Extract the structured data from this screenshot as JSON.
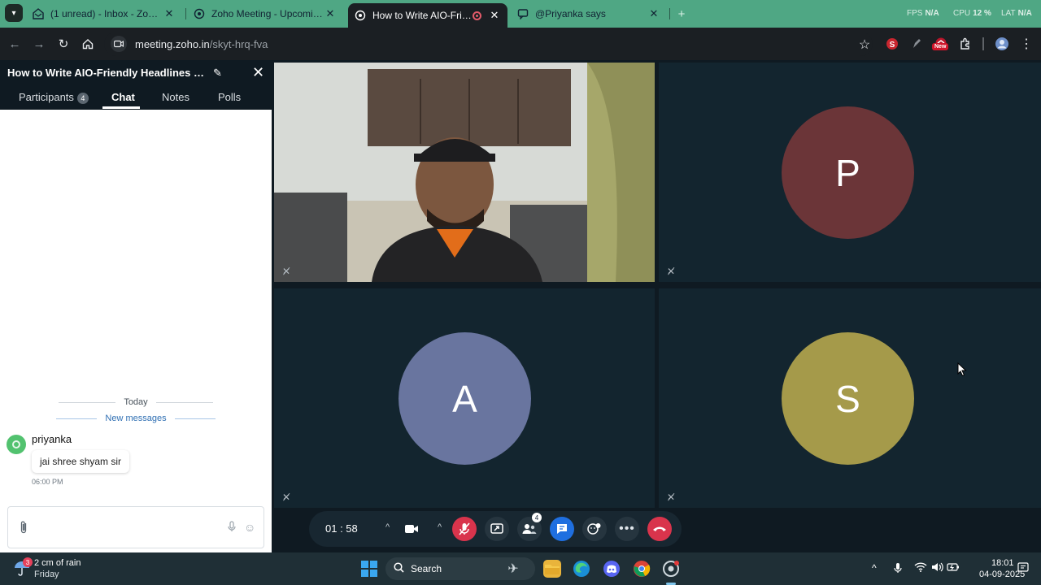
{
  "browser": {
    "tabs": [
      {
        "title": "(1 unread) - Inbox - Zoho Mail",
        "icon": "mail-icon"
      },
      {
        "title": "Zoho Meeting - Upcoming Me",
        "icon": "zoho-meeting-icon"
      },
      {
        "title": "How to Write AIO-Friendly",
        "icon": "zoho-meeting-icon",
        "active": true,
        "recording": true
      },
      {
        "title": "@Priyanka says",
        "icon": "chat-icon"
      }
    ],
    "perf": {
      "fps_label": "FPS",
      "fps_value": "N/A",
      "cpu_label": "CPU",
      "cpu_value": "12 %",
      "lat_label": "LAT",
      "lat_value": "N/A"
    },
    "url_host": "meeting.zoho.in",
    "url_path": "/skyt-hrq-fva",
    "ext_badge": "New"
  },
  "panel": {
    "title": "How to Write AIO-Friendly Headlines & M...",
    "tabs": {
      "participants": "Participants",
      "participants_count": "4",
      "chat": "Chat",
      "notes": "Notes",
      "polls": "Polls"
    },
    "divider_today": "Today",
    "divider_new": "New messages",
    "message": {
      "sender": "priyanka",
      "text": "jai shree shyam sir",
      "time": "06:00 PM"
    },
    "compose_placeholder": ""
  },
  "tiles": [
    {
      "type": "video",
      "name": "Presenter camera"
    },
    {
      "type": "avatar",
      "initial": "P",
      "color": "#6b3538"
    },
    {
      "type": "avatar",
      "initial": "A",
      "color": "#69759f"
    },
    {
      "type": "avatar",
      "initial": "S",
      "color": "#a59a4a"
    }
  ],
  "controls": {
    "timer": "01 : 58",
    "participants_badge": "4"
  },
  "taskbar": {
    "weather_badge": "3",
    "weather_line1": "2 cm of rain",
    "weather_line2": "Friday",
    "search": "Search",
    "time": "18:01",
    "date": "04-09-2025"
  }
}
